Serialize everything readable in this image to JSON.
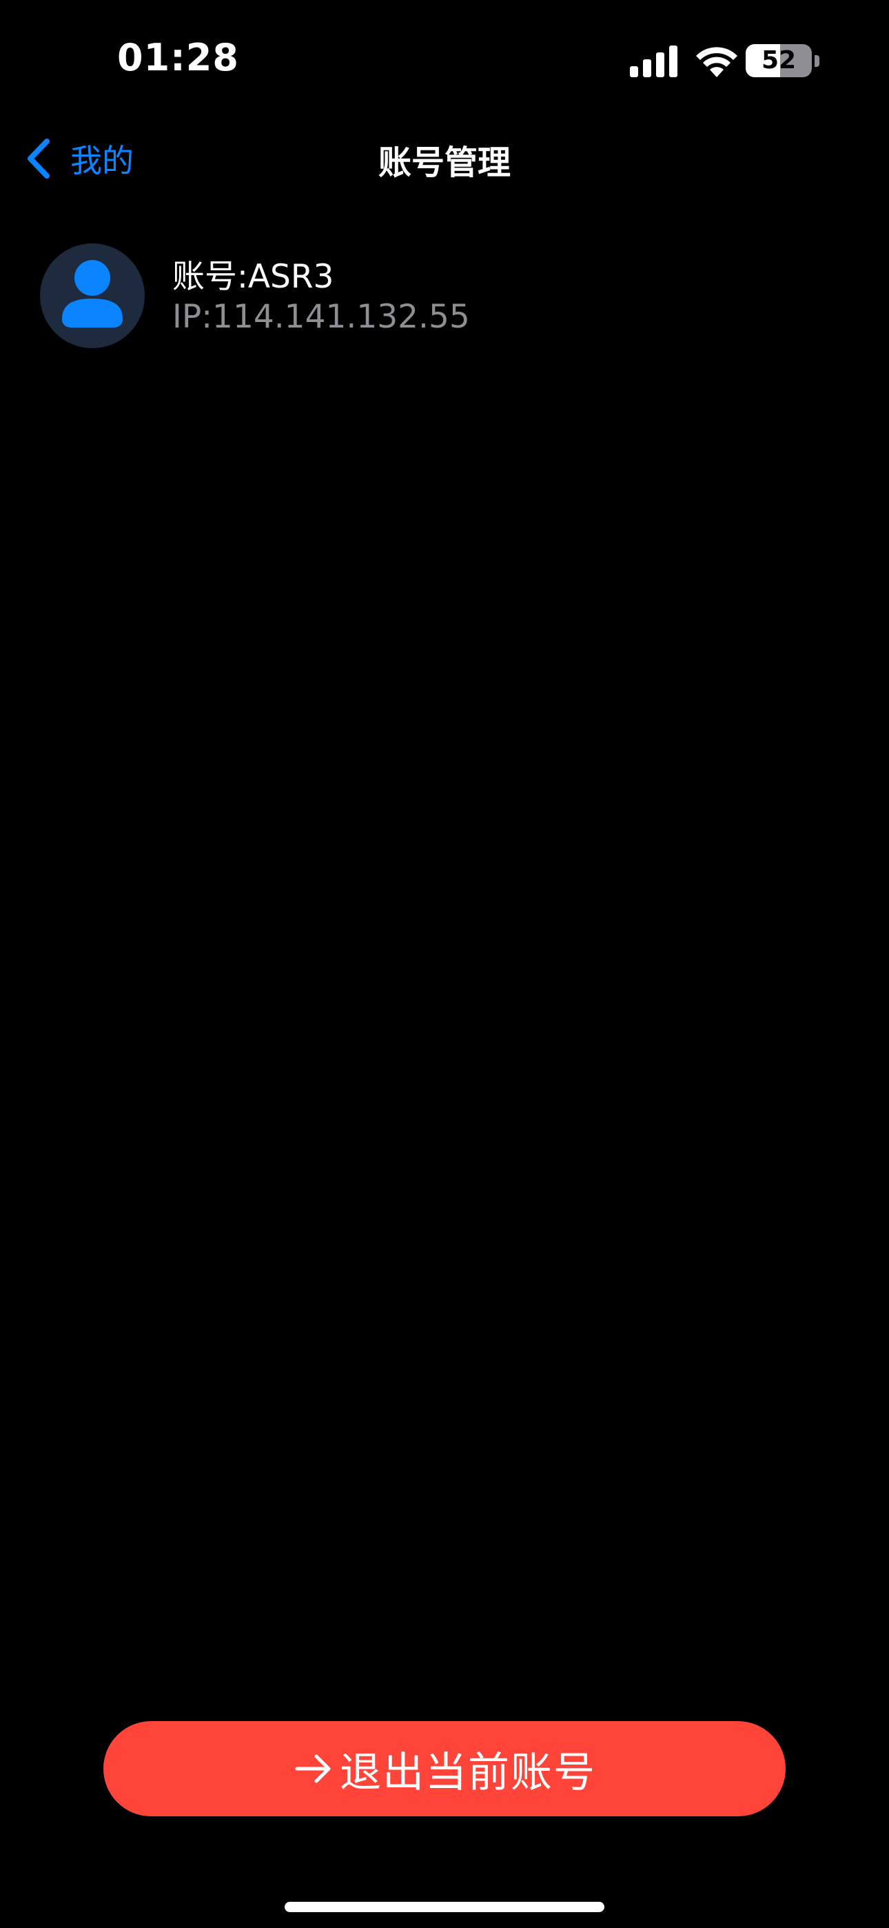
{
  "status_bar": {
    "time": "01:28",
    "battery_level": "52",
    "battery_fraction": 0.52,
    "icons": [
      "signal-bars-icon",
      "wifi-icon",
      "battery-icon"
    ]
  },
  "nav": {
    "back_label": "我的",
    "title": "账号管理"
  },
  "account": {
    "name": "账号:ASR3",
    "ip": "IP:114.141.132.55"
  },
  "logout": {
    "label": "退出当前账号"
  },
  "colors": {
    "background": "#000000",
    "accent_blue": "#0a84ff",
    "danger_red": "#ff453a",
    "secondary_text": "#8e8e93",
    "avatar_bg": "#1e2a3d"
  }
}
